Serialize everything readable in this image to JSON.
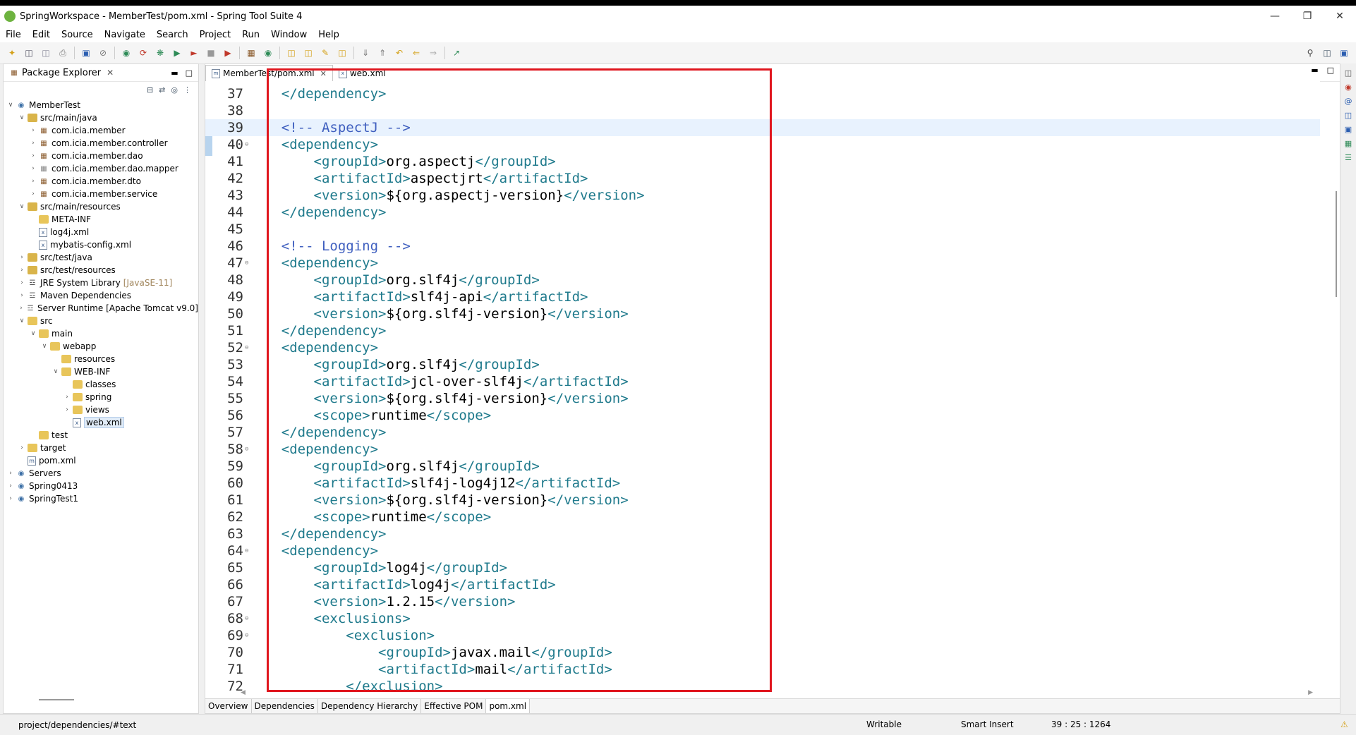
{
  "window": {
    "title": "SpringWorkspace - MemberTest/pom.xml - Spring Tool Suite 4"
  },
  "menu": [
    "File",
    "Edit",
    "Source",
    "Navigate",
    "Search",
    "Project",
    "Run",
    "Window",
    "Help"
  ],
  "package_explorer": {
    "title": "Package Explorer",
    "tree": [
      {
        "label": "MemberTest",
        "icon": "project-icon"
      },
      {
        "label": "src/main/java",
        "icon": "source-folder-icon"
      },
      {
        "label": "com.icia.member",
        "icon": "package-icon"
      },
      {
        "label": "com.icia.member.controller",
        "icon": "package-icon"
      },
      {
        "label": "com.icia.member.dao",
        "icon": "package-icon"
      },
      {
        "label": "com.icia.member.dao.mapper",
        "icon": "package-icon"
      },
      {
        "label": "com.icia.member.dto",
        "icon": "package-icon"
      },
      {
        "label": "com.icia.member.service",
        "icon": "package-icon"
      },
      {
        "label": "src/main/resources",
        "icon": "source-folder-icon"
      },
      {
        "label": "META-INF",
        "icon": "folder-icon"
      },
      {
        "label": "log4j.xml",
        "icon": "xml-file-icon"
      },
      {
        "label": "mybatis-config.xml",
        "icon": "xml-file-icon"
      },
      {
        "label": "src/test/java",
        "icon": "source-folder-icon"
      },
      {
        "label": "src/test/resources",
        "icon": "source-folder-icon"
      },
      {
        "label": "JRE System Library",
        "annotation": "[JavaSE-11]",
        "icon": "library-icon"
      },
      {
        "label": "Maven Dependencies",
        "icon": "library-icon"
      },
      {
        "label": "Server Runtime [Apache Tomcat v9.0]",
        "icon": "library-icon"
      },
      {
        "label": "src",
        "icon": "folder-icon"
      },
      {
        "label": "main",
        "icon": "folder-icon"
      },
      {
        "label": "webapp",
        "icon": "folder-icon"
      },
      {
        "label": "resources",
        "icon": "folder-icon"
      },
      {
        "label": "WEB-INF",
        "icon": "folder-icon"
      },
      {
        "label": "classes",
        "icon": "folder-icon"
      },
      {
        "label": "spring",
        "icon": "folder-icon"
      },
      {
        "label": "views",
        "icon": "folder-icon"
      },
      {
        "label": "web.xml",
        "icon": "xml-file-icon"
      },
      {
        "label": "test",
        "icon": "folder-icon"
      },
      {
        "label": "target",
        "icon": "folder-icon"
      },
      {
        "label": "pom.xml",
        "icon": "xml-file-icon"
      },
      {
        "label": "Servers",
        "icon": "project-icon"
      },
      {
        "label": "Spring0413",
        "icon": "project-icon"
      },
      {
        "label": "SpringTest1",
        "icon": "project-icon"
      }
    ]
  },
  "editor": {
    "tabs": [
      "MemberTest/pom.xml",
      "web.xml"
    ],
    "lines": [
      {
        "n": "37",
        "indent": "    ",
        "parts": [
          [
            "tag",
            "</dependency>"
          ]
        ]
      },
      {
        "n": "38",
        "indent": "",
        "parts": []
      },
      {
        "n": "39",
        "indent": "    ",
        "parts": [
          [
            "cm",
            "<!-- AspectJ -->"
          ]
        ]
      },
      {
        "n": "40",
        "indent": "    ",
        "parts": [
          [
            "tag",
            "<dependency>"
          ]
        ]
      },
      {
        "n": "41",
        "indent": "        ",
        "parts": [
          [
            "tag",
            "<groupId>"
          ],
          [
            "txt",
            "org.aspectj"
          ],
          [
            "tag",
            "</groupId>"
          ]
        ]
      },
      {
        "n": "42",
        "indent": "        ",
        "parts": [
          [
            "tag",
            "<artifactId>"
          ],
          [
            "txt",
            "aspectjrt"
          ],
          [
            "tag",
            "</artifactId>"
          ]
        ]
      },
      {
        "n": "43",
        "indent": "        ",
        "parts": [
          [
            "tag",
            "<version>"
          ],
          [
            "txt",
            "${org.aspectj-version}"
          ],
          [
            "tag",
            "</version>"
          ]
        ]
      },
      {
        "n": "44",
        "indent": "    ",
        "parts": [
          [
            "tag",
            "</dependency>"
          ]
        ]
      },
      {
        "n": "45",
        "indent": "",
        "parts": []
      },
      {
        "n": "46",
        "indent": "    ",
        "parts": [
          [
            "cm",
            "<!-- Logging -->"
          ]
        ]
      },
      {
        "n": "47",
        "indent": "    ",
        "parts": [
          [
            "tag",
            "<dependency>"
          ]
        ]
      },
      {
        "n": "48",
        "indent": "        ",
        "parts": [
          [
            "tag",
            "<groupId>"
          ],
          [
            "txt",
            "org.slf4j"
          ],
          [
            "tag",
            "</groupId>"
          ]
        ]
      },
      {
        "n": "49",
        "indent": "        ",
        "parts": [
          [
            "tag",
            "<artifactId>"
          ],
          [
            "txt",
            "slf4j-api"
          ],
          [
            "tag",
            "</artifactId>"
          ]
        ]
      },
      {
        "n": "50",
        "indent": "        ",
        "parts": [
          [
            "tag",
            "<version>"
          ],
          [
            "txt",
            "${org.slf4j-version}"
          ],
          [
            "tag",
            "</version>"
          ]
        ]
      },
      {
        "n": "51",
        "indent": "    ",
        "parts": [
          [
            "tag",
            "</dependency>"
          ]
        ]
      },
      {
        "n": "52",
        "indent": "    ",
        "parts": [
          [
            "tag",
            "<dependency>"
          ]
        ]
      },
      {
        "n": "53",
        "indent": "        ",
        "parts": [
          [
            "tag",
            "<groupId>"
          ],
          [
            "txt",
            "org.slf4j"
          ],
          [
            "tag",
            "</groupId>"
          ]
        ]
      },
      {
        "n": "54",
        "indent": "        ",
        "parts": [
          [
            "tag",
            "<artifactId>"
          ],
          [
            "txt",
            "jcl-over-slf4j"
          ],
          [
            "tag",
            "</artifactId>"
          ]
        ]
      },
      {
        "n": "55",
        "indent": "        ",
        "parts": [
          [
            "tag",
            "<version>"
          ],
          [
            "txt",
            "${org.slf4j-version}"
          ],
          [
            "tag",
            "</version>"
          ]
        ]
      },
      {
        "n": "56",
        "indent": "        ",
        "parts": [
          [
            "tag",
            "<scope>"
          ],
          [
            "txt",
            "runtime"
          ],
          [
            "tag",
            "</scope>"
          ]
        ]
      },
      {
        "n": "57",
        "indent": "    ",
        "parts": [
          [
            "tag",
            "</dependency>"
          ]
        ]
      },
      {
        "n": "58",
        "indent": "    ",
        "parts": [
          [
            "tag",
            "<dependency>"
          ]
        ]
      },
      {
        "n": "59",
        "indent": "        ",
        "parts": [
          [
            "tag",
            "<groupId>"
          ],
          [
            "txt",
            "org.slf4j"
          ],
          [
            "tag",
            "</groupId>"
          ]
        ]
      },
      {
        "n": "60",
        "indent": "        ",
        "parts": [
          [
            "tag",
            "<artifactId>"
          ],
          [
            "txt",
            "slf4j-log4j12"
          ],
          [
            "tag",
            "</artifactId>"
          ]
        ]
      },
      {
        "n": "61",
        "indent": "        ",
        "parts": [
          [
            "tag",
            "<version>"
          ],
          [
            "txt",
            "${org.slf4j-version}"
          ],
          [
            "tag",
            "</version>"
          ]
        ]
      },
      {
        "n": "62",
        "indent": "        ",
        "parts": [
          [
            "tag",
            "<scope>"
          ],
          [
            "txt",
            "runtime"
          ],
          [
            "tag",
            "</scope>"
          ]
        ]
      },
      {
        "n": "63",
        "indent": "    ",
        "parts": [
          [
            "tag",
            "</dependency>"
          ]
        ]
      },
      {
        "n": "64",
        "indent": "    ",
        "parts": [
          [
            "tag",
            "<dependency>"
          ]
        ]
      },
      {
        "n": "65",
        "indent": "        ",
        "parts": [
          [
            "tag",
            "<groupId>"
          ],
          [
            "txt",
            "log4j"
          ],
          [
            "tag",
            "</groupId>"
          ]
        ]
      },
      {
        "n": "66",
        "indent": "        ",
        "parts": [
          [
            "tag",
            "<artifactId>"
          ],
          [
            "txt",
            "log4j"
          ],
          [
            "tag",
            "</artifactId>"
          ]
        ]
      },
      {
        "n": "67",
        "indent": "        ",
        "parts": [
          [
            "tag",
            "<version>"
          ],
          [
            "txt",
            "1.2.15"
          ],
          [
            "tag",
            "</version>"
          ]
        ]
      },
      {
        "n": "68",
        "indent": "        ",
        "parts": [
          [
            "tag",
            "<exclusions>"
          ]
        ]
      },
      {
        "n": "69",
        "indent": "            ",
        "parts": [
          [
            "tag",
            "<exclusion>"
          ]
        ]
      },
      {
        "n": "70",
        "indent": "                ",
        "parts": [
          [
            "tag",
            "<groupId>"
          ],
          [
            "txt",
            "javax.mail"
          ],
          [
            "tag",
            "</groupId>"
          ]
        ]
      },
      {
        "n": "71",
        "indent": "                ",
        "parts": [
          [
            "tag",
            "<artifactId>"
          ],
          [
            "txt",
            "mail"
          ],
          [
            "tag",
            "</artifactId>"
          ]
        ]
      },
      {
        "n": "72",
        "indent": "            ",
        "parts": [
          [
            "tag",
            "</exclusion>"
          ]
        ]
      }
    ],
    "bottom_tabs": [
      "Overview",
      "Dependencies",
      "Dependency Hierarchy",
      "Effective POM",
      "pom.xml"
    ]
  },
  "status": {
    "path": "project/dependencies/#text",
    "mode": "Writable",
    "insert": "Smart Insert",
    "position": "39 : 25 : 1264"
  },
  "colors": {
    "highlight_box": "#e0161e",
    "xml_tag": "#1f7a8c",
    "comment": "#3f5fbf"
  }
}
